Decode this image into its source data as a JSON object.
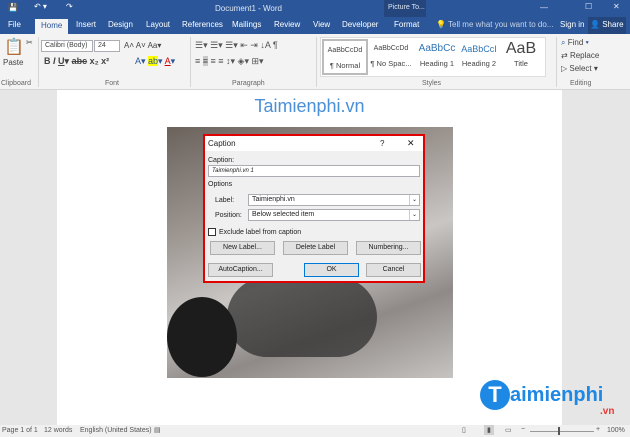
{
  "window": {
    "title": "Document1 - Word",
    "context_tab": "Picture To..."
  },
  "tabs": [
    "File",
    "Home",
    "Insert",
    "Design",
    "Layout",
    "References",
    "Mailings",
    "Review",
    "View",
    "Developer",
    "Format"
  ],
  "tell_me": "Tell me what you want to do...",
  "sign_in": "Sign in",
  "share": "Share",
  "ribbon": {
    "paste": "Paste",
    "font_name": "Calibri (Body)",
    "font_size": "24",
    "groups": {
      "clipboard": "Clipboard",
      "font": "Font",
      "paragraph": "Paragraph",
      "styles": "Styles",
      "editing": "Editing"
    },
    "styles": [
      {
        "preview": "AaBbCcDd",
        "label": "¶ Normal"
      },
      {
        "preview": "AaBbCcDd",
        "label": "¶ No Spac..."
      },
      {
        "preview": "AaBbCc",
        "label": "Heading 1"
      },
      {
        "preview": "AaBbCcI",
        "label": "Heading 2"
      },
      {
        "preview": "AaB",
        "label": "Title"
      }
    ],
    "find": "Find",
    "replace": "Replace",
    "select": "Select"
  },
  "document": {
    "heading": "Taimienphi.vn"
  },
  "dialog": {
    "title": "Caption",
    "help": "?",
    "caption_label": "Caption:",
    "caption_value": "Taimienphi.vn  1",
    "options": "Options",
    "label_label": "Label:",
    "label_value": "Taimienphi.vn",
    "position_label": "Position:",
    "position_value": "Below selected item",
    "exclude": "Exclude label from caption",
    "new_label": "New Label...",
    "delete_label": "Delete Label",
    "numbering": "Numbering...",
    "autocaption": "AutoCaption...",
    "ok": "OK",
    "cancel": "Cancel"
  },
  "status": {
    "page": "Page 1 of 1",
    "words": "12 words",
    "language": "English (United States)",
    "zoom": "100%"
  },
  "watermark": {
    "brand": "aimienphi",
    "suffix": ".vn"
  }
}
